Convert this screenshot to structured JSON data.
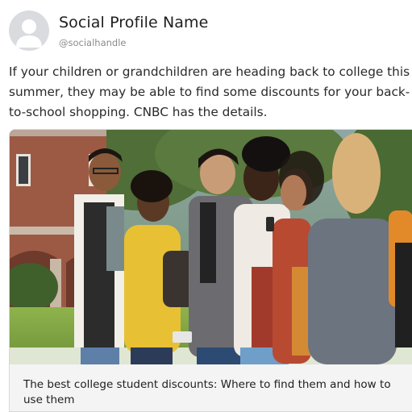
{
  "profile": {
    "name": "Social Profile Name",
    "handle": "@socialhandle",
    "avatar_icon": "user-silhouette-icon"
  },
  "post": {
    "text": "If your children or grandchildren are heading back to college this summer, they may be able to find some discounts for your back-to-school shopping. CNBC has the details."
  },
  "link_card": {
    "title": "The best college student discounts: Where to find them and how to use them"
  },
  "colors": {
    "avatar_bg": "#d9dbdf",
    "card_bg": "#f4f4f4",
    "border": "#d8d8d8"
  }
}
